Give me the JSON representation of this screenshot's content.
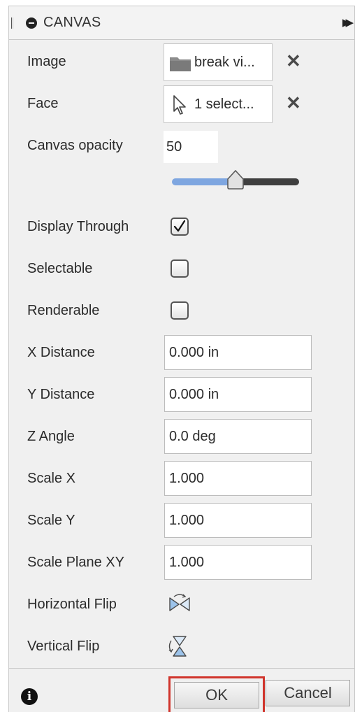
{
  "header": {
    "title": "CANVAS"
  },
  "rows": {
    "image": {
      "label": "Image",
      "value": "break vi..."
    },
    "face": {
      "label": "Face",
      "value": "1 select..."
    },
    "opacity": {
      "label": "Canvas opacity",
      "value": "50",
      "slider_fraction": 0.5
    },
    "display_through": {
      "label": "Display Through",
      "checked": true
    },
    "selectable": {
      "label": "Selectable",
      "checked": false
    },
    "renderable": {
      "label": "Renderable",
      "checked": false
    },
    "x_distance": {
      "label": "X Distance",
      "value": "0.000 in"
    },
    "y_distance": {
      "label": "Y Distance",
      "value": "0.000 in"
    },
    "z_angle": {
      "label": "Z Angle",
      "value": "0.0 deg"
    },
    "scale_x": {
      "label": "Scale X",
      "value": "1.000"
    },
    "scale_y": {
      "label": "Scale Y",
      "value": "1.000"
    },
    "scale_plane_xy": {
      "label": "Scale Plane XY",
      "value": "1.000"
    },
    "horizontal_flip": {
      "label": "Horizontal Flip"
    },
    "vertical_flip": {
      "label": "Vertical Flip"
    }
  },
  "clear_glyph": "✕",
  "footer": {
    "ok_label": "OK",
    "cancel_label": "Cancel",
    "info_glyph": "i"
  },
  "icons": [
    "collapse-icon",
    "fast-forward-icon",
    "folder-icon",
    "cursor-arrow-icon",
    "clear-icon",
    "checkmark-icon",
    "horizontal-flip-icon",
    "vertical-flip-icon",
    "info-icon"
  ],
  "colors": {
    "accent_slider": "#7ea6e0",
    "highlight": "#d0342c",
    "panel_bg": "#f0f0f0"
  }
}
